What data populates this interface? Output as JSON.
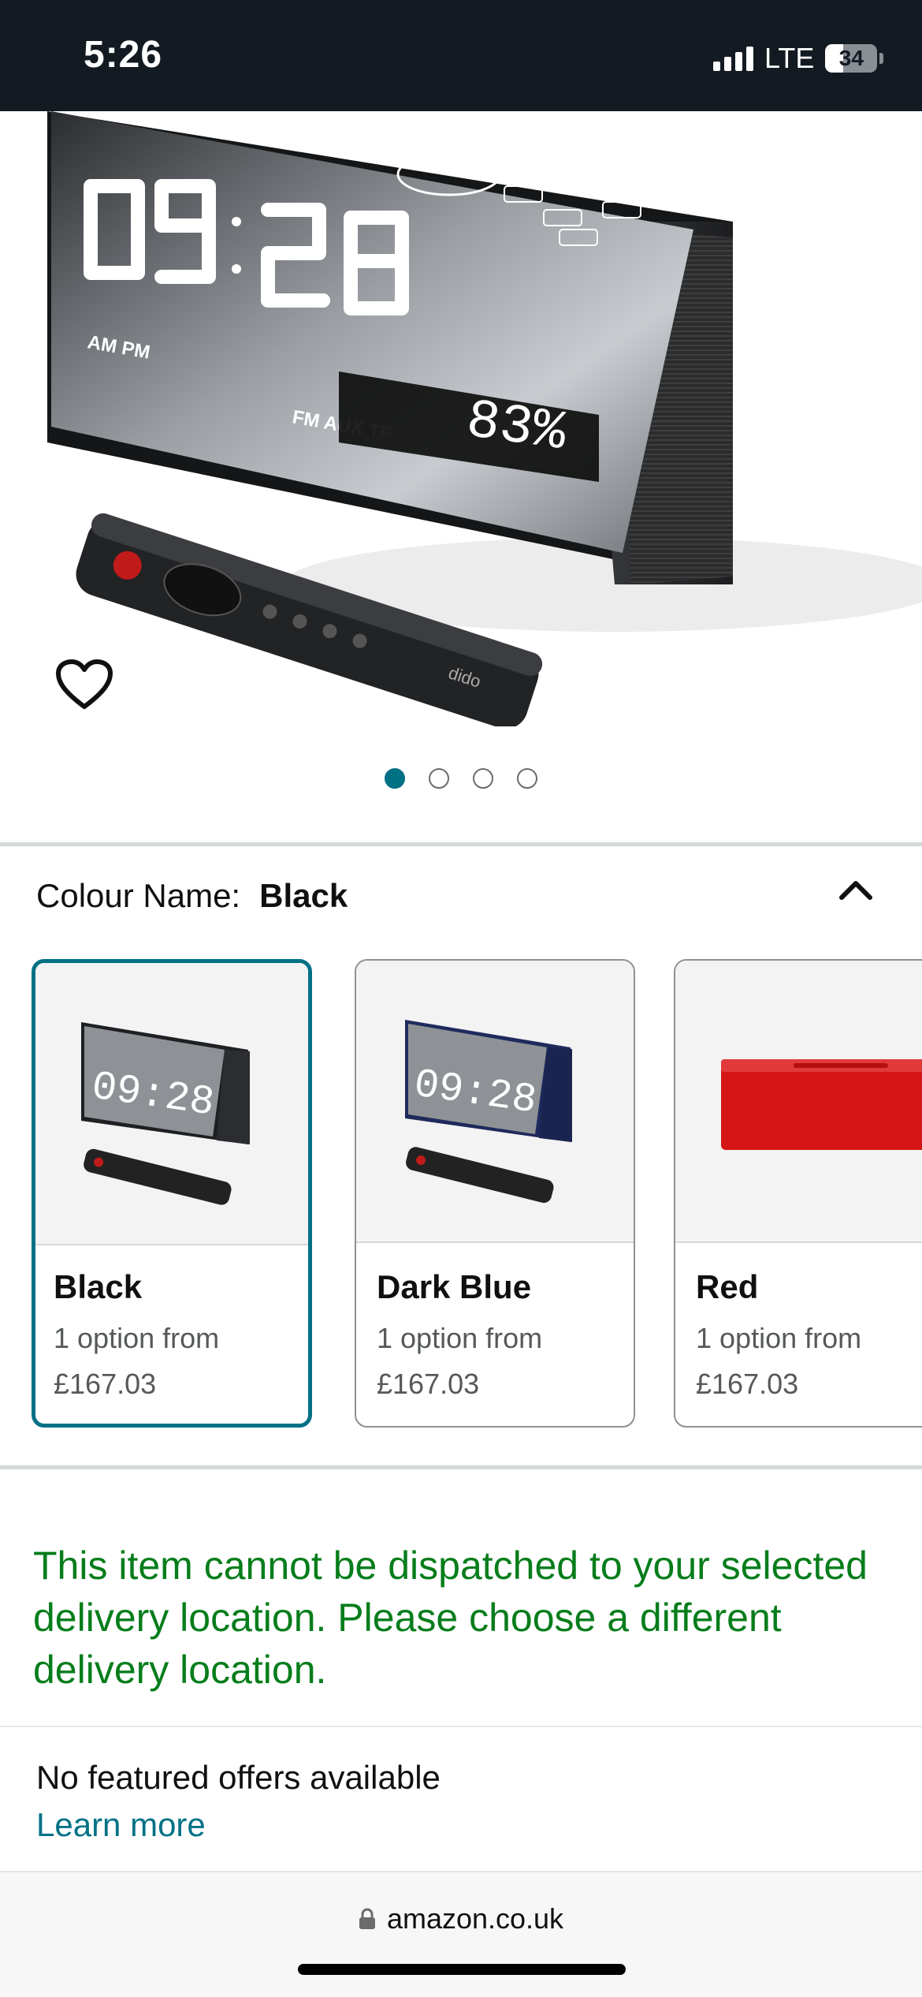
{
  "status_bar": {
    "time": "5:26",
    "network": "LTE",
    "battery_percent": "34",
    "battery_level": 0.34,
    "signal_bars": 4
  },
  "product": {
    "image_icon": "product-photo-alarm-clock-speaker",
    "wishlist_icon": "heart-outline-icon",
    "carousel": {
      "count": 4,
      "active_index": 0
    }
  },
  "colour": {
    "label": "Colour Name:",
    "selected": "Black",
    "toggle_icon": "chevron-up-icon"
  },
  "swatches": [
    {
      "name": "Black",
      "option_text": "1 option from",
      "price": "£167.03",
      "selected": true,
      "color": "#1a1a1a"
    },
    {
      "name": "Dark Blue",
      "option_text": "1 option from",
      "price": "£167.03",
      "selected": false,
      "color": "#1f2a5c"
    },
    {
      "name": "Red",
      "option_text": "1 option from",
      "price": "£167.03",
      "selected": false,
      "color": "#d41616"
    }
  ],
  "delivery": {
    "message": "This item cannot be dispatched to your selected delivery location. Please choose a different delivery location."
  },
  "offers": {
    "none_text": "No featured offers available",
    "learn_more": "Learn more"
  },
  "browser": {
    "url": "amazon.co.uk",
    "lock_icon": "lock-icon"
  },
  "colors": {
    "teal_accent": "#007185",
    "success_green": "#067d1b",
    "status_bar_bg": "#131a22"
  }
}
